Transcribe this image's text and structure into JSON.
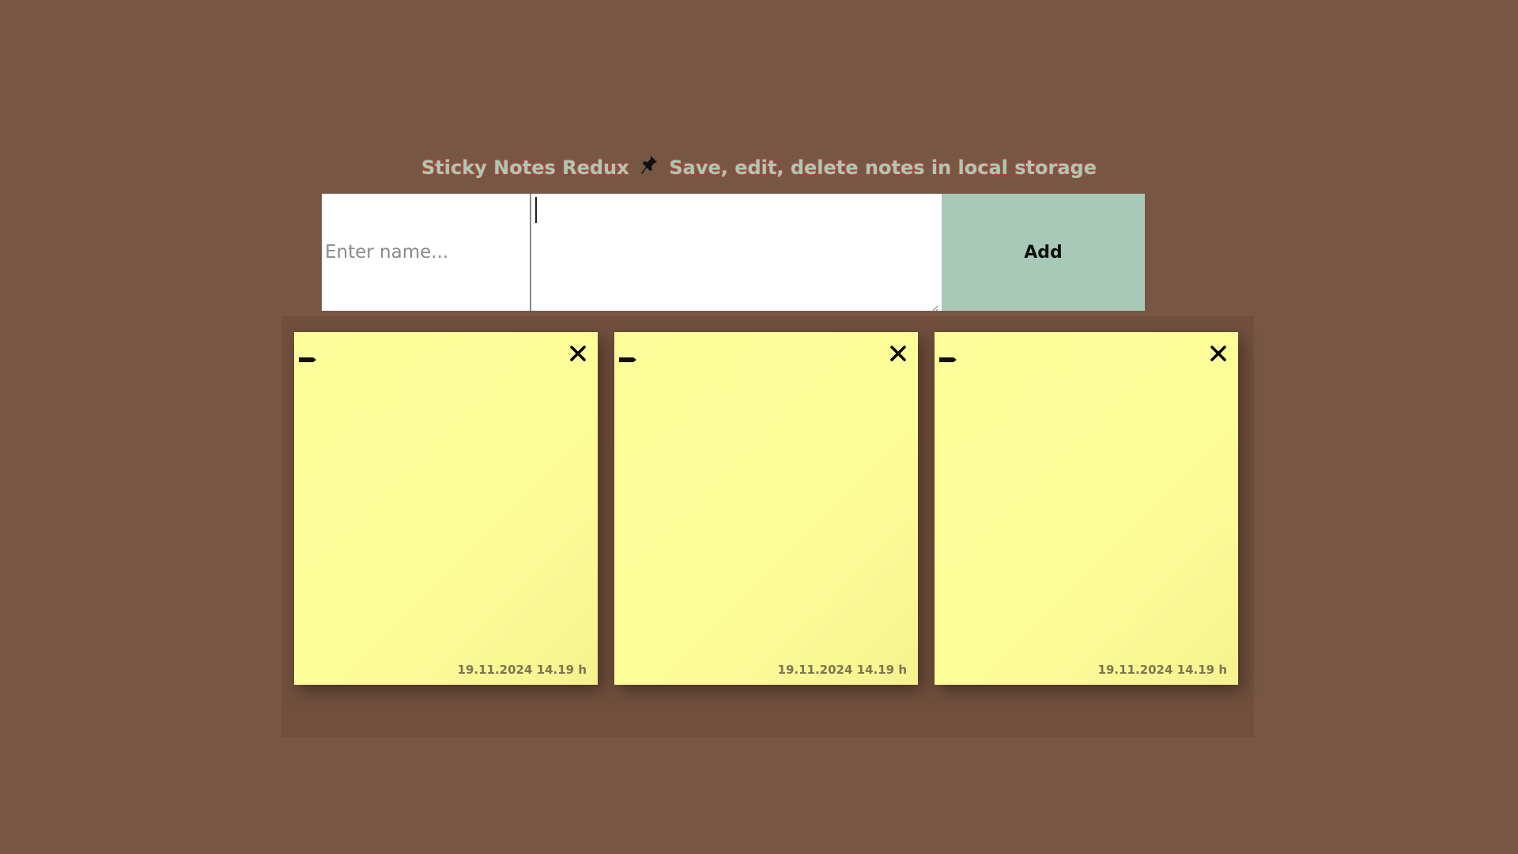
{
  "header": {
    "title_left": "Sticky Notes Redux",
    "title_right": "Save, edit, delete notes in local storage",
    "pin_icon": "pushpin-icon"
  },
  "form": {
    "name_placeholder": "Enter name...",
    "name_value": "",
    "content_value": "",
    "add_label": "Add"
  },
  "colors": {
    "background": "#775744",
    "accent": "#a9c9b8",
    "note": "#fdfe9b",
    "title_outline": "#b24a3a"
  },
  "notes": [
    {
      "content": "",
      "date": "19.11.2024 14.19 h"
    },
    {
      "content": "",
      "date": "19.11.2024 14.19 h"
    },
    {
      "content": "",
      "date": "19.11.2024 14.19 h"
    }
  ]
}
